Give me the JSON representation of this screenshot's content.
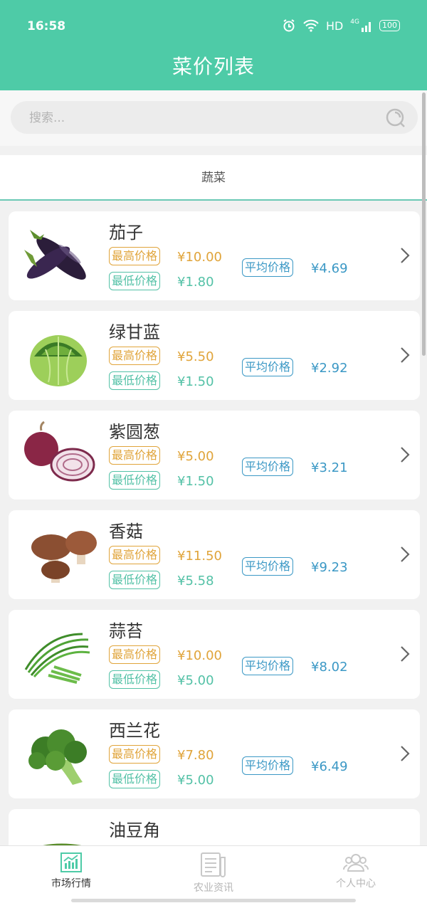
{
  "status": {
    "time": "16:58",
    "network": "HD",
    "signal": "4G",
    "battery": "100"
  },
  "header": {
    "title": "菜价列表"
  },
  "search": {
    "placeholder": "搜索..."
  },
  "category_tab": {
    "label": "蔬菜"
  },
  "labels": {
    "max": "最高价格",
    "min": "最低价格",
    "avg": "平均价格"
  },
  "items": [
    {
      "name": "茄子",
      "max": "¥10.00",
      "min": "¥1.80",
      "avg": "¥4.69",
      "image": "eggplant"
    },
    {
      "name": "绿甘蓝",
      "max": "¥5.50",
      "min": "¥1.50",
      "avg": "¥2.92",
      "image": "cabbage"
    },
    {
      "name": "紫圆葱",
      "max": "¥5.00",
      "min": "¥1.50",
      "avg": "¥3.21",
      "image": "red-onion"
    },
    {
      "name": "香菇",
      "max": "¥11.50",
      "min": "¥5.58",
      "avg": "¥9.23",
      "image": "mushroom"
    },
    {
      "name": "蒜苔",
      "max": "¥10.00",
      "min": "¥5.00",
      "avg": "¥8.02",
      "image": "garlic-sprout"
    },
    {
      "name": "西兰花",
      "max": "¥7.80",
      "min": "¥5.00",
      "avg": "¥6.49",
      "image": "broccoli"
    },
    {
      "name": "油豆角",
      "max": "",
      "min": "",
      "avg": "",
      "image": "green-bean"
    }
  ],
  "bottom_nav": [
    {
      "label": "市场行情",
      "icon": "chart-icon",
      "active": true
    },
    {
      "label": "农业资讯",
      "icon": "news-icon",
      "active": false
    },
    {
      "label": "个人中心",
      "icon": "user-icon",
      "active": false
    }
  ],
  "colors": {
    "primary": "#4ecba7",
    "max": "#e0a43a",
    "min": "#53c1a6",
    "avg": "#3b98c5"
  }
}
